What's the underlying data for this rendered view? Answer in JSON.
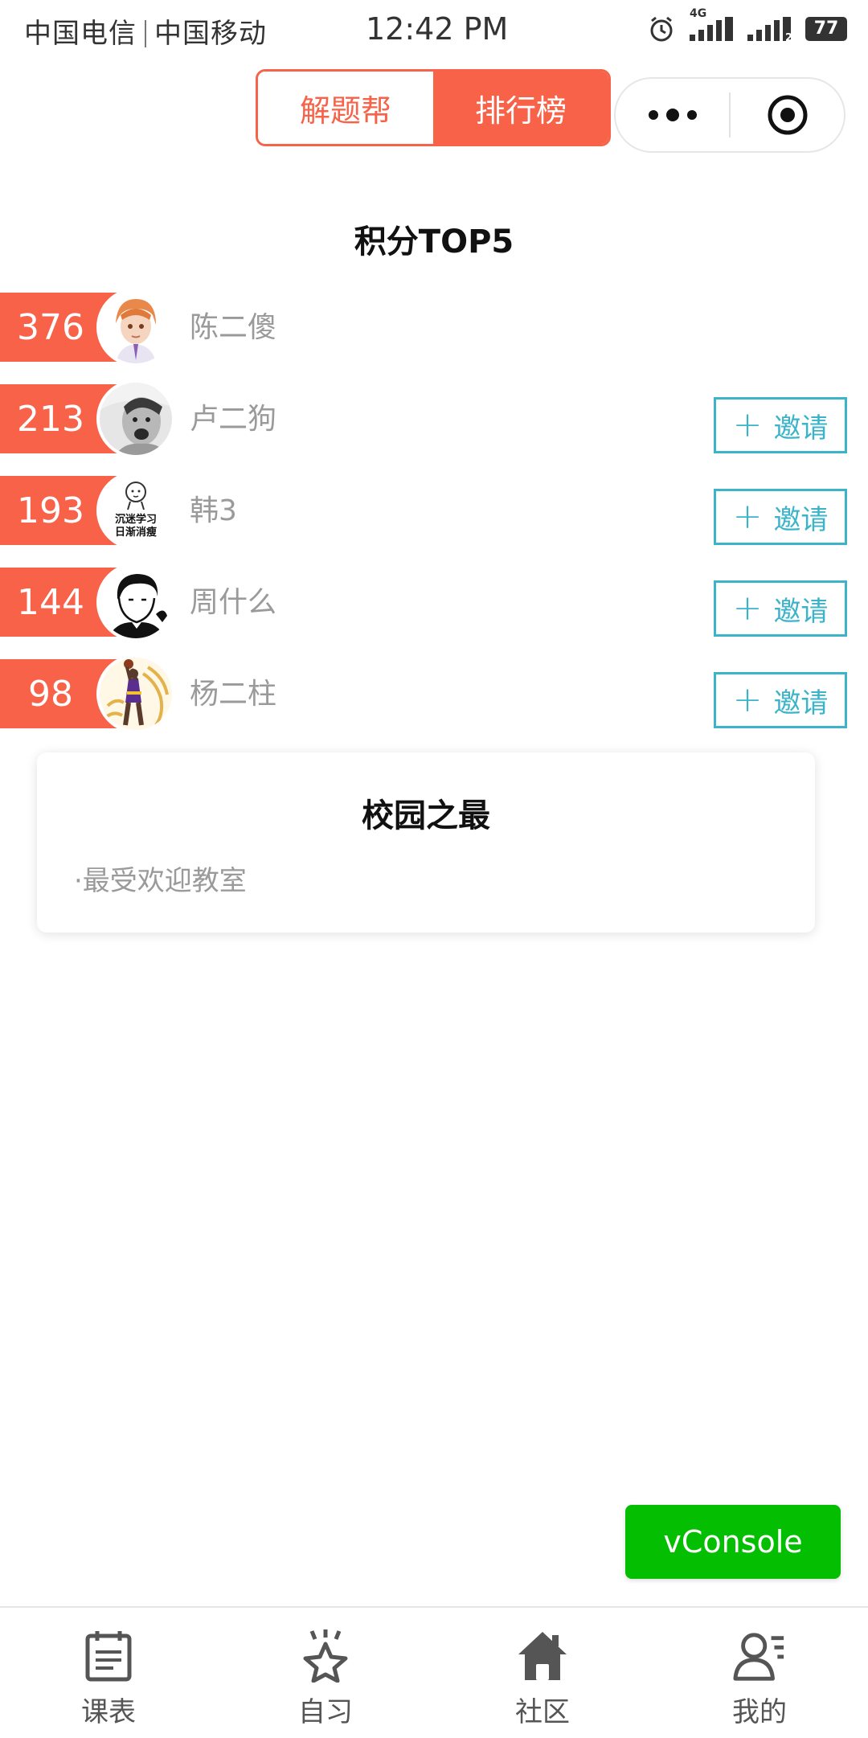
{
  "status_bar": {
    "carrier_left": "中国电信",
    "carrier_right": "中国移动",
    "time": "12:42 PM",
    "network_label": "4G",
    "sim2_label": "2",
    "battery": "77"
  },
  "segmented": {
    "tabs": [
      "解题帮",
      "排行榜"
    ],
    "selected": "排行榜"
  },
  "capsule": {
    "more_icon": "more-dots-icon",
    "close_icon": "target-close-icon"
  },
  "leaderboard": {
    "title": "积分TOP5",
    "invite_label": "邀请",
    "rows": [
      {
        "score": "376",
        "name": "陈二傻",
        "avatar": "avatar-anime-boy"
      },
      {
        "score": "213",
        "name": "卢二狗",
        "avatar": "avatar-screaming-man"
      },
      {
        "score": "193",
        "name": "韩3",
        "avatar": "avatar-meme-sticker"
      },
      {
        "score": "144",
        "name": "周什么",
        "avatar": "avatar-sketch-boy"
      },
      {
        "score": "98",
        "name": "杨二柱",
        "avatar": "avatar-basketball-player"
      }
    ]
  },
  "avatar_texts": {
    "meme_line1": "沉迷学习",
    "meme_line2": "日渐消瘦"
  },
  "campus": {
    "title": "校园之最",
    "items": [
      "·最受欢迎教室"
    ]
  },
  "vconsole": {
    "label": "vConsole"
  },
  "tabbar": {
    "items": [
      {
        "label": "课表",
        "icon": "schedule-icon"
      },
      {
        "label": "自习",
        "icon": "star-icon"
      },
      {
        "label": "社区",
        "icon": "home-icon"
      },
      {
        "label": "我的",
        "icon": "profile-icon"
      }
    ]
  },
  "colors": {
    "accent": "#f76249",
    "invite": "#3bb4c9",
    "vconsole": "#04be02"
  }
}
